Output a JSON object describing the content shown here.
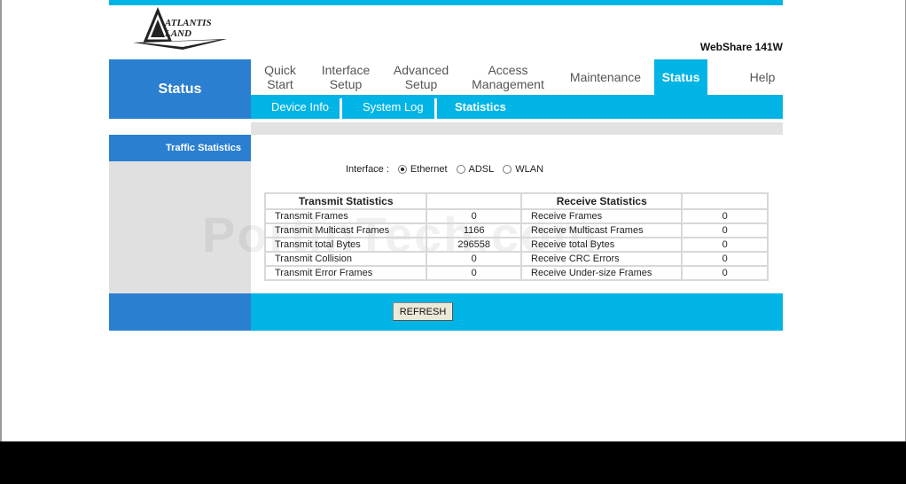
{
  "header": {
    "logo_text": "ATLANTIS LAND",
    "model": "WebShare 141W"
  },
  "section_title": "Status",
  "nav": [
    {
      "line1": "Quick",
      "line2": "Start"
    },
    {
      "line1": "Interface",
      "line2": "Setup"
    },
    {
      "line1": "Advanced",
      "line2": "Setup"
    },
    {
      "line1": "Access",
      "line2": "Management"
    },
    {
      "line1": "Maintenance",
      "line2": ""
    },
    {
      "line1": "Status",
      "line2": ""
    },
    {
      "line1": "Help",
      "line2": ""
    }
  ],
  "subnav": [
    "Device Info",
    "System Log",
    "Statistics"
  ],
  "sidebar": {
    "heading": "Traffic Statistics"
  },
  "interface": {
    "label": "Interface :",
    "options": [
      "Ethernet",
      "ADSL",
      "WLAN"
    ],
    "selected": "Ethernet"
  },
  "table": {
    "headers": [
      "Transmit Statistics",
      "Receive Statistics"
    ],
    "rows": [
      {
        "tx_label": "Transmit Frames",
        "tx_value": "0",
        "rx_label": "Receive Frames",
        "rx_value": "0"
      },
      {
        "tx_label": "Transmit Multicast Frames",
        "tx_value": "1166",
        "rx_label": "Receive Multicast Frames",
        "rx_value": "0"
      },
      {
        "tx_label": "Transmit total Bytes",
        "tx_value": "296558",
        "rx_label": "Receive total Bytes",
        "rx_value": "0"
      },
      {
        "tx_label": "Transmit Collision",
        "tx_value": "0",
        "rx_label": "Receive CRC Errors",
        "rx_value": "0"
      },
      {
        "tx_label": "Transmit Error Frames",
        "tx_value": "0",
        "rx_label": "Receive Under-size Frames",
        "rx_value": "0"
      }
    ]
  },
  "refresh_label": "REFRESH",
  "watermark": "PortinTech.com",
  "colors": {
    "blue": "#2b7fd0",
    "cyan": "#00b4e6",
    "gray": "#e0e0e0"
  }
}
